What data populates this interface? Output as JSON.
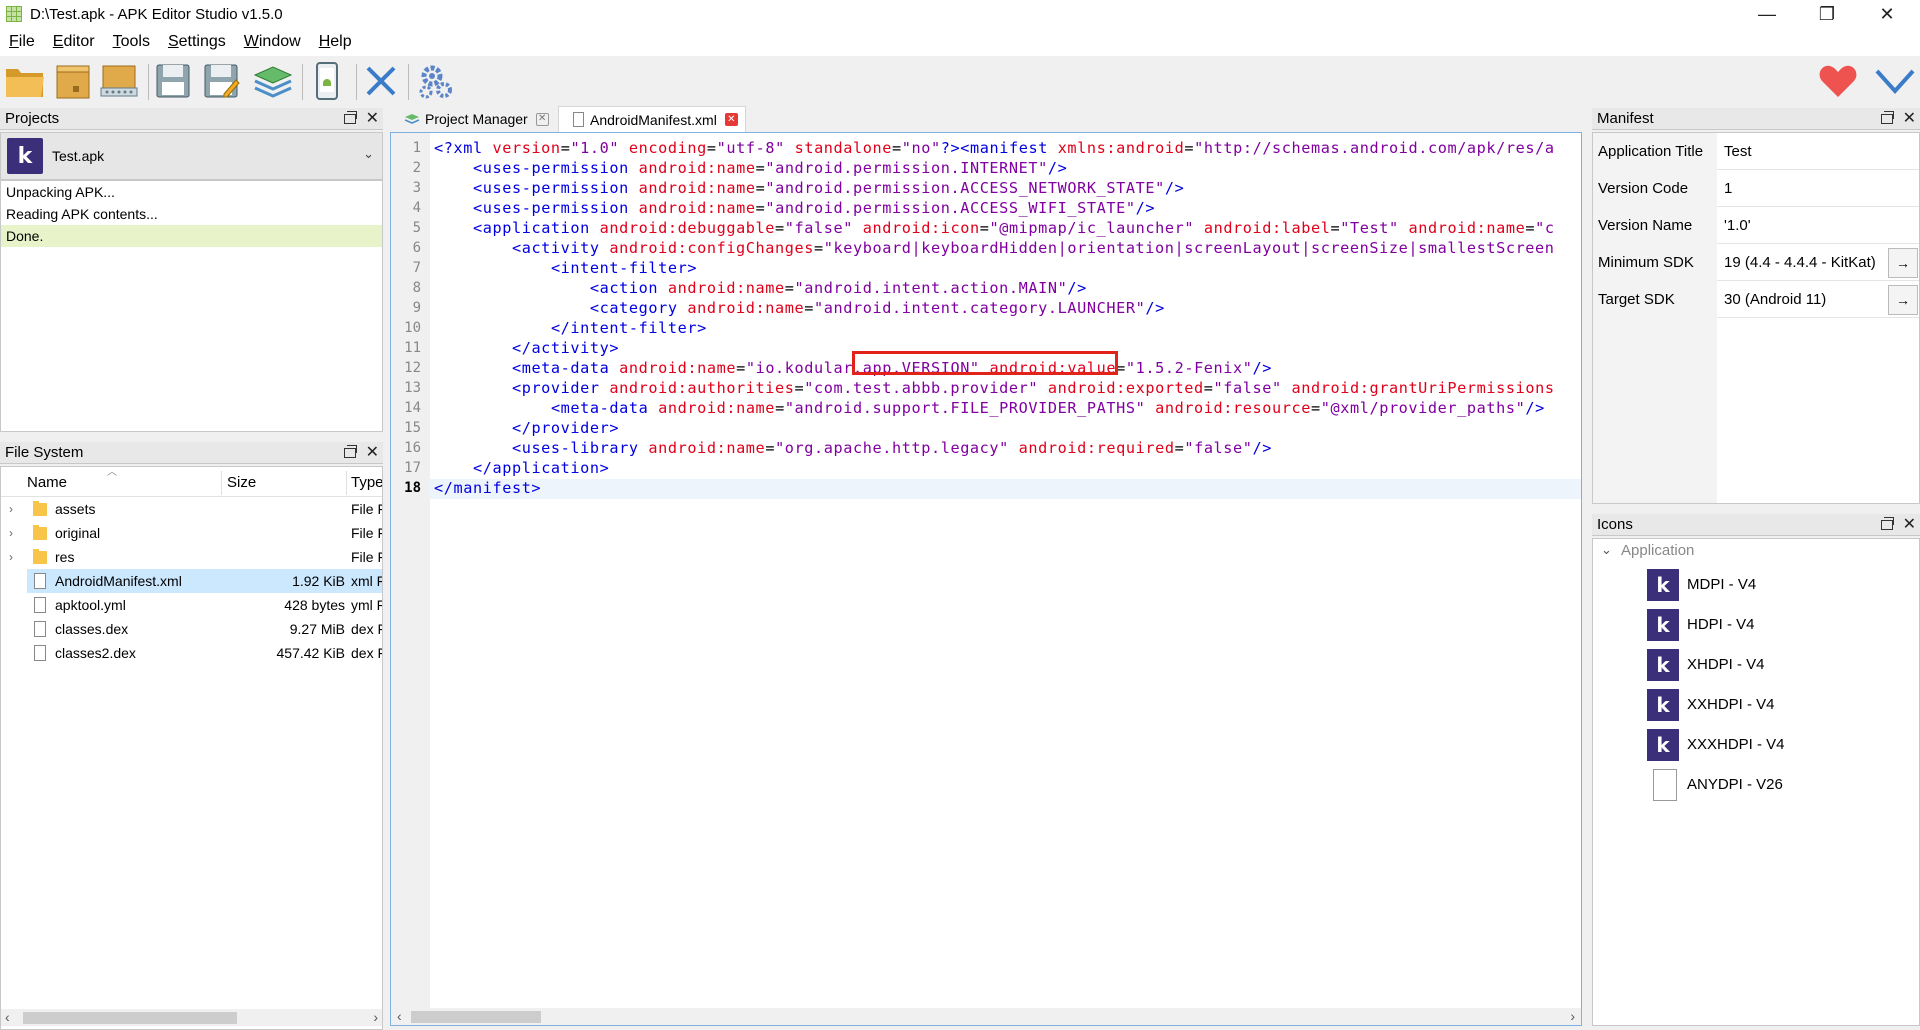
{
  "window": {
    "title": "D:\\Test.apk - APK Editor Studio v1.5.0",
    "minimize": "—",
    "maximize": "❐",
    "close": "✕"
  },
  "menu": {
    "items": [
      {
        "label": "File",
        "accel": "F",
        "rest": "ile"
      },
      {
        "label": "Editor",
        "accel": "E",
        "rest": "ditor"
      },
      {
        "label": "Tools",
        "accel": "T",
        "rest": "ools"
      },
      {
        "label": "Settings",
        "accel": "S",
        "rest": "ettings"
      },
      {
        "label": "Window",
        "accel": "W",
        "rest": "indow"
      },
      {
        "label": "Help",
        "accel": "H",
        "rest": "elp"
      }
    ]
  },
  "toolbar": {
    "icons": [
      "open-apk-icon",
      "open-folder-icon",
      "open-archive-icon",
      "save-icon",
      "save-as-icon",
      "layers-icon",
      "install-device-icon",
      "close-project-icon",
      "settings-gears-icon",
      "donate-heart-icon",
      "check-update-icon"
    ]
  },
  "projects": {
    "title": "Projects",
    "selected": "Test.apk",
    "log": [
      "Unpacking APK...",
      "Reading APK contents...",
      "Done."
    ]
  },
  "filesystem": {
    "title": "File System",
    "columns": [
      "Name",
      "Size",
      "Type"
    ],
    "rows": [
      {
        "name": "assets",
        "size": "",
        "type": "File Folder",
        "kind": "folder"
      },
      {
        "name": "original",
        "size": "",
        "type": "File Folder",
        "kind": "folder"
      },
      {
        "name": "res",
        "size": "",
        "type": "File Folder",
        "kind": "folder"
      },
      {
        "name": "AndroidManifest.xml",
        "size": "1.92 KiB",
        "type": "xml File",
        "kind": "file"
      },
      {
        "name": "apktool.yml",
        "size": "428 bytes",
        "type": "yml File",
        "kind": "file"
      },
      {
        "name": "classes.dex",
        "size": "9.27 MiB",
        "type": "dex File",
        "kind": "file"
      },
      {
        "name": "classes2.dex",
        "size": "457.42 KiB",
        "type": "dex File",
        "kind": "file"
      }
    ]
  },
  "tabs": [
    {
      "label": "Project Manager",
      "active": false
    },
    {
      "label": "AndroidManifest.xml",
      "active": true
    }
  ],
  "editor": {
    "lines": [
      [
        [
          "t",
          "<?xml "
        ],
        [
          "a",
          "version"
        ],
        [
          "p",
          "="
        ],
        [
          "v",
          "\"1.0\""
        ],
        [
          "p",
          " "
        ],
        [
          "a",
          "encoding"
        ],
        [
          "p",
          "="
        ],
        [
          "v",
          "\"utf-8\""
        ],
        [
          "p",
          " "
        ],
        [
          "a",
          "standalone"
        ],
        [
          "p",
          "="
        ],
        [
          "v",
          "\"no\""
        ],
        [
          "t",
          "?>"
        ],
        [
          "t",
          "<manifest "
        ],
        [
          "a",
          "xmlns:android"
        ],
        [
          "p",
          "="
        ],
        [
          "v",
          "\"http://schemas.android.com/apk/res/a"
        ]
      ],
      [
        [
          "p",
          "    "
        ],
        [
          "t",
          "<uses-permission "
        ],
        [
          "a",
          "android:name"
        ],
        [
          "p",
          "="
        ],
        [
          "v",
          "\"android.permission.INTERNET\""
        ],
        [
          "t",
          "/>"
        ]
      ],
      [
        [
          "p",
          "    "
        ],
        [
          "t",
          "<uses-permission "
        ],
        [
          "a",
          "android:name"
        ],
        [
          "p",
          "="
        ],
        [
          "v",
          "\"android.permission.ACCESS_NETWORK_STATE\""
        ],
        [
          "t",
          "/>"
        ]
      ],
      [
        [
          "p",
          "    "
        ],
        [
          "t",
          "<uses-permission "
        ],
        [
          "a",
          "android:name"
        ],
        [
          "p",
          "="
        ],
        [
          "v",
          "\"android.permission.ACCESS_WIFI_STATE\""
        ],
        [
          "t",
          "/>"
        ]
      ],
      [
        [
          "p",
          "    "
        ],
        [
          "t",
          "<application "
        ],
        [
          "a",
          "android:debuggable"
        ],
        [
          "p",
          "="
        ],
        [
          "v",
          "\"false\""
        ],
        [
          "p",
          " "
        ],
        [
          "a",
          "android:icon"
        ],
        [
          "p",
          "="
        ],
        [
          "v",
          "\"@mipmap/ic_launcher\""
        ],
        [
          "p",
          " "
        ],
        [
          "a",
          "android:label"
        ],
        [
          "p",
          "="
        ],
        [
          "v",
          "\"Test\""
        ],
        [
          "p",
          " "
        ],
        [
          "a",
          "android:name"
        ],
        [
          "p",
          "="
        ],
        [
          "v",
          "\"c"
        ]
      ],
      [
        [
          "p",
          "        "
        ],
        [
          "t",
          "<activity "
        ],
        [
          "a",
          "android:configChanges"
        ],
        [
          "p",
          "="
        ],
        [
          "v",
          "\"keyboard|keyboardHidden|orientation|screenLayout|screenSize|smallestScreen"
        ]
      ],
      [
        [
          "p",
          "            "
        ],
        [
          "t",
          "<intent-filter>"
        ]
      ],
      [
        [
          "p",
          "                "
        ],
        [
          "t",
          "<action "
        ],
        [
          "a",
          "android:name"
        ],
        [
          "p",
          "="
        ],
        [
          "v",
          "\"android.intent.action.MAIN\""
        ],
        [
          "t",
          "/>"
        ]
      ],
      [
        [
          "p",
          "                "
        ],
        [
          "t",
          "<category "
        ],
        [
          "a",
          "android:name"
        ],
        [
          "p",
          "="
        ],
        [
          "v",
          "\"android.intent.category.LAUNCHER\""
        ],
        [
          "t",
          "/>"
        ]
      ],
      [
        [
          "p",
          "            "
        ],
        [
          "t",
          "</intent-filter>"
        ]
      ],
      [
        [
          "p",
          "        "
        ],
        [
          "t",
          "</activity>"
        ]
      ],
      [
        [
          "p",
          "        "
        ],
        [
          "t",
          "<meta-data "
        ],
        [
          "a",
          "android:name"
        ],
        [
          "p",
          "="
        ],
        [
          "v",
          "\"io.kodular.app.VERSION\""
        ],
        [
          "p",
          " "
        ],
        [
          "a",
          "android:value"
        ],
        [
          "p",
          "="
        ],
        [
          "v",
          "\"1.5.2-Fenix\""
        ],
        [
          "t",
          "/>"
        ]
      ],
      [
        [
          "p",
          "        "
        ],
        [
          "t",
          "<provider "
        ],
        [
          "a",
          "android:authorities"
        ],
        [
          "p",
          "="
        ],
        [
          "v",
          "\"com.test.abbb.provider\""
        ],
        [
          "p",
          " "
        ],
        [
          "a",
          "android:exported"
        ],
        [
          "p",
          "="
        ],
        [
          "v",
          "\"false\""
        ],
        [
          "p",
          " "
        ],
        [
          "a",
          "android:grantUriPermissions"
        ]
      ],
      [
        [
          "p",
          "            "
        ],
        [
          "t",
          "<meta-data "
        ],
        [
          "a",
          "android:name"
        ],
        [
          "p",
          "="
        ],
        [
          "v",
          "\"android.support.FILE_PROVIDER_PATHS\""
        ],
        [
          "p",
          " "
        ],
        [
          "a",
          "android:resource"
        ],
        [
          "p",
          "="
        ],
        [
          "v",
          "\"@xml/provider_paths\""
        ],
        [
          "t",
          "/>"
        ]
      ],
      [
        [
          "p",
          "        "
        ],
        [
          "t",
          "</provider>"
        ]
      ],
      [
        [
          "p",
          "        "
        ],
        [
          "t",
          "<uses-library "
        ],
        [
          "a",
          "android:name"
        ],
        [
          "p",
          "="
        ],
        [
          "v",
          "\"org.apache.http.legacy\""
        ],
        [
          "p",
          " "
        ],
        [
          "a",
          "android:required"
        ],
        [
          "p",
          "="
        ],
        [
          "v",
          "\"false\""
        ],
        [
          "t",
          "/>"
        ]
      ],
      [
        [
          "p",
          "    "
        ],
        [
          "t",
          "</application>"
        ]
      ],
      [
        [
          "t",
          "</manifest>"
        ]
      ]
    ],
    "current_line": "18"
  },
  "manifest": {
    "title": "Manifest",
    "rows": [
      {
        "label": "Application Title",
        "value": "Test",
        "has_arrow": false
      },
      {
        "label": "Version Code",
        "value": "1",
        "has_arrow": false
      },
      {
        "label": "Version Name",
        "value": "'1.0'",
        "has_arrow": false
      },
      {
        "label": "Minimum SDK",
        "value": "19 (4.4 - 4.4.4 - KitKat)",
        "has_arrow": true
      },
      {
        "label": "Target SDK",
        "value": "30 (Android 11)",
        "has_arrow": true
      }
    ],
    "arrow": "→"
  },
  "icons": {
    "title": "Icons",
    "group": "Application",
    "items": [
      {
        "label": "MDPI - V4",
        "kind": "k"
      },
      {
        "label": "HDPI - V4",
        "kind": "k"
      },
      {
        "label": "XHDPI - V4",
        "kind": "k"
      },
      {
        "label": "XXHDPI - V4",
        "kind": "k"
      },
      {
        "label": "XXXHDPI - V4",
        "kind": "k"
      },
      {
        "label": "ANYDPI - V26",
        "kind": "file"
      }
    ]
  },
  "colors": {
    "tag": "#0000e0",
    "attribute": "#e0001a",
    "value": "#8000a0",
    "highlight_box": "#e2231a",
    "app_icon_bg": "#3b2f7a",
    "selection": "#cce8ff"
  }
}
